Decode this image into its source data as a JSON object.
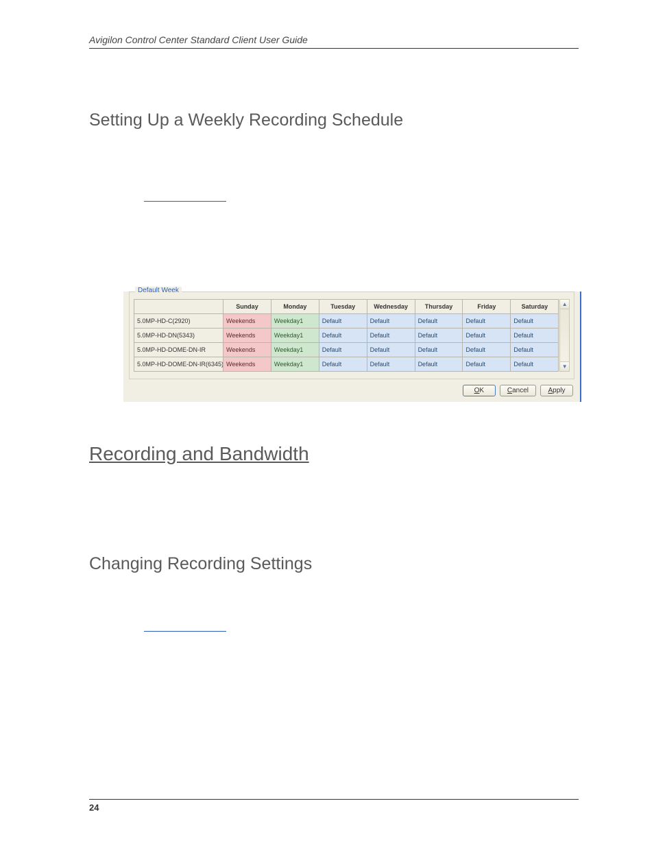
{
  "header": {
    "title": "Avigilon Control Center Standard Client User Guide"
  },
  "sections": {
    "weekly_schedule_title": "Setting Up a Weekly Recording Schedule",
    "recording_bandwidth_title": "Recording and Bandwidth",
    "changing_recording_title": "Changing Recording Settings"
  },
  "dialog": {
    "group_title": "Default Week",
    "columns": [
      "Sunday",
      "Monday",
      "Tuesday",
      "Wednesday",
      "Thursday",
      "Friday",
      "Saturday"
    ],
    "templates": {
      "weekends": "Weekends",
      "weekday1": "Weekday1",
      "default": "Default"
    },
    "rows": [
      {
        "camera": "5.0MP-HD-C(2920)",
        "cells": [
          "weekends",
          "weekday1",
          "default",
          "default",
          "default",
          "default",
          "default"
        ]
      },
      {
        "camera": "5.0MP-HD-DN(5343)",
        "cells": [
          "weekends",
          "weekday1",
          "default",
          "default",
          "default",
          "default",
          "default"
        ]
      },
      {
        "camera": "5.0MP-HD-DOME-DN-IR",
        "cells": [
          "weekends",
          "weekday1",
          "default",
          "default",
          "default",
          "default",
          "default"
        ]
      },
      {
        "camera": "5.0MP-HD-DOME-DN-IR(6345)",
        "cells": [
          "weekends",
          "weekday1",
          "default",
          "default",
          "default",
          "default",
          "default"
        ]
      }
    ],
    "buttons": {
      "ok": "OK",
      "cancel": "Cancel",
      "apply": "Apply"
    }
  },
  "footer": {
    "page_number": "24"
  }
}
